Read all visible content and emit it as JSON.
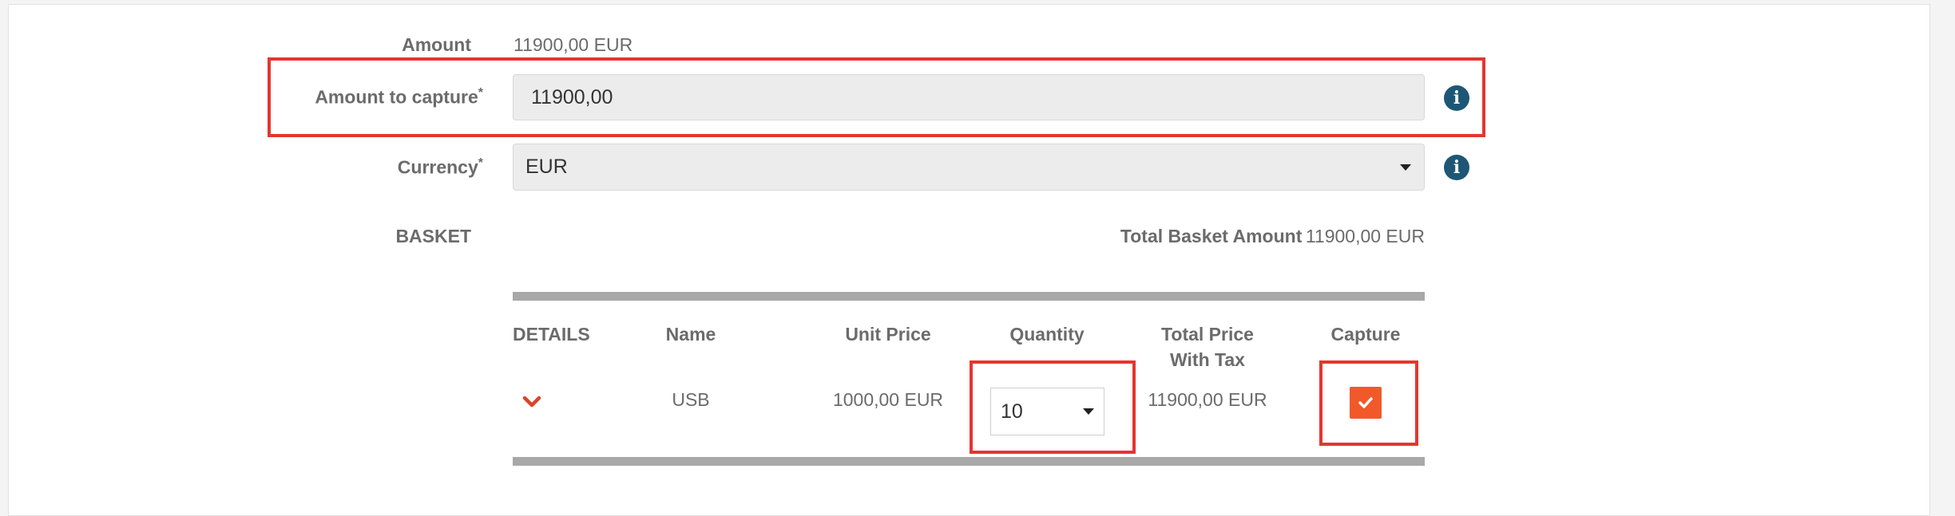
{
  "form": {
    "amount_label": "Amount",
    "amount_value": "11900,00 EUR",
    "amount_to_capture_label": "Amount to capture",
    "amount_to_capture_value": "11900,00",
    "currency_label": "Currency",
    "currency_value": "EUR",
    "required_mark": "*"
  },
  "basket": {
    "title": "BASKET",
    "total_label": "Total Basket Amount",
    "total_value": "11900,00 EUR",
    "columns": {
      "details": "DETAILS",
      "name": "Name",
      "unit_price": "Unit Price",
      "quantity": "Quantity",
      "total_price_line1": "Total Price",
      "total_price_line2": "With Tax",
      "capture": "Capture"
    },
    "rows": [
      {
        "name": "USB",
        "unit_price": "1000,00 EUR",
        "quantity": "10",
        "total_price": "11900,00 EUR",
        "capture_checked": true
      }
    ]
  },
  "icons": {
    "info": "info-icon",
    "dropdown": "caret-down-icon",
    "expand": "chevron-down-icon",
    "check": "check-icon"
  },
  "colors": {
    "highlight": "#e53530",
    "info_icon": "#1d5775",
    "checkbox": "#f1592a",
    "chevron": "#d9452b"
  }
}
